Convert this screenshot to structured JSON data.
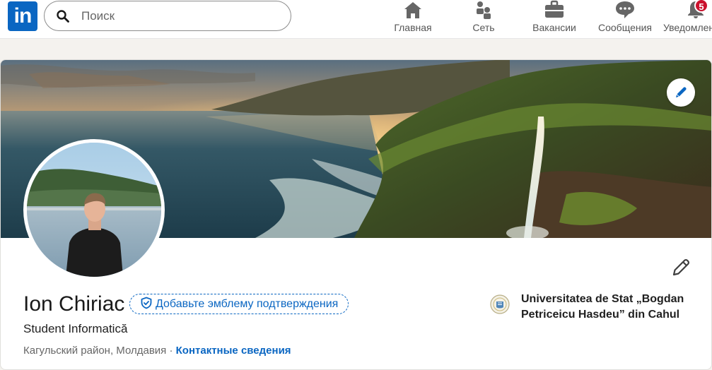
{
  "nav": {
    "logo_text": "in",
    "search_placeholder": "Поиск",
    "items": [
      {
        "label": "Главная",
        "icon": "home-icon"
      },
      {
        "label": "Сеть",
        "icon": "network-icon"
      },
      {
        "label": "Вакансии",
        "icon": "briefcase-icon"
      },
      {
        "label": "Сообщения",
        "icon": "messages-icon"
      },
      {
        "label": "Уведомления",
        "icon": "bell-icon",
        "badge": "5"
      }
    ]
  },
  "profile": {
    "name": "Ion Chiriac",
    "verify_label": "Добавьте эмблему подтверждения",
    "headline": "Student Informatică",
    "location": "Кагульский район, Молдавия",
    "location_separator": " · ",
    "contact_label": "Контактные сведения",
    "education": "Universitatea de Stat „Bogdan Petriceicu Hasdeu” din Cahul"
  },
  "colors": {
    "brand": "#0a66c2",
    "badge": "#cb112d"
  }
}
